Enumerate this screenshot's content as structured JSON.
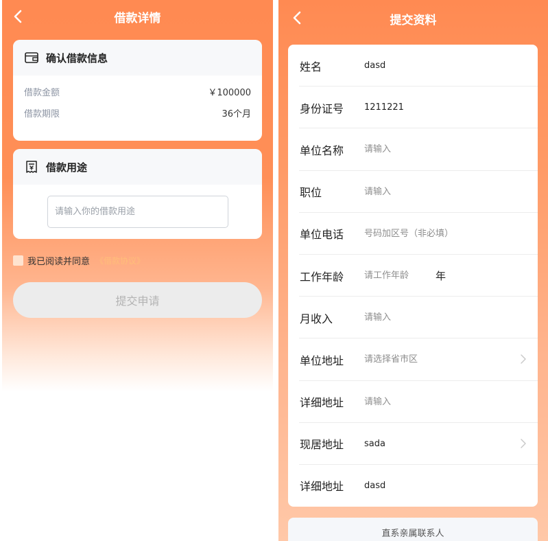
{
  "left": {
    "title": "借款详情",
    "confirm_card": {
      "title": "确认借款信息",
      "rows": [
        {
          "label": "借款金额",
          "value": "￥100000"
        },
        {
          "label": "借款期限",
          "value": "36个月"
        }
      ]
    },
    "purpose_card": {
      "title": "借款用途",
      "placeholder": "请输入你的借款用途",
      "value": ""
    },
    "agreement": {
      "text": "我已阅读并同意",
      "link": "《借款协议》"
    },
    "submit_label": "提交申请"
  },
  "right": {
    "title": "提交资料",
    "fields": [
      {
        "label": "姓名",
        "value": "dasd",
        "placeholder": ""
      },
      {
        "label": "身份证号",
        "value": "1211221",
        "placeholder": ""
      },
      {
        "label": "单位名称",
        "value": "",
        "placeholder": "请输入"
      },
      {
        "label": "职位",
        "value": "",
        "placeholder": "请输入"
      },
      {
        "label": "单位电话",
        "value": "",
        "placeholder": "号码加区号（非必填）"
      },
      {
        "label": "工作年龄",
        "value": "",
        "placeholder": "请工作年龄",
        "unit": "年"
      },
      {
        "label": "月收入",
        "value": "",
        "placeholder": "请输入"
      },
      {
        "label": "单位地址",
        "value": "",
        "placeholder": "请选择省市区"
      },
      {
        "label": "详细地址",
        "value": "",
        "placeholder": "请输入"
      },
      {
        "label": "现居地址",
        "value": "sada",
        "placeholder": ""
      },
      {
        "label": "详细地址",
        "value": "dasd",
        "placeholder": ""
      }
    ],
    "contact_title": "直系亲属联系人"
  },
  "icons": {
    "back": "chevron-left-icon",
    "wallet": "wallet-icon",
    "receipt": "receipt-icon",
    "chevron_right": "chevron-right-icon"
  },
  "colors": {
    "brand_orange": "#ff8a52",
    "link_orange": "#ffbe7a",
    "disabled_button": "#ececec"
  }
}
